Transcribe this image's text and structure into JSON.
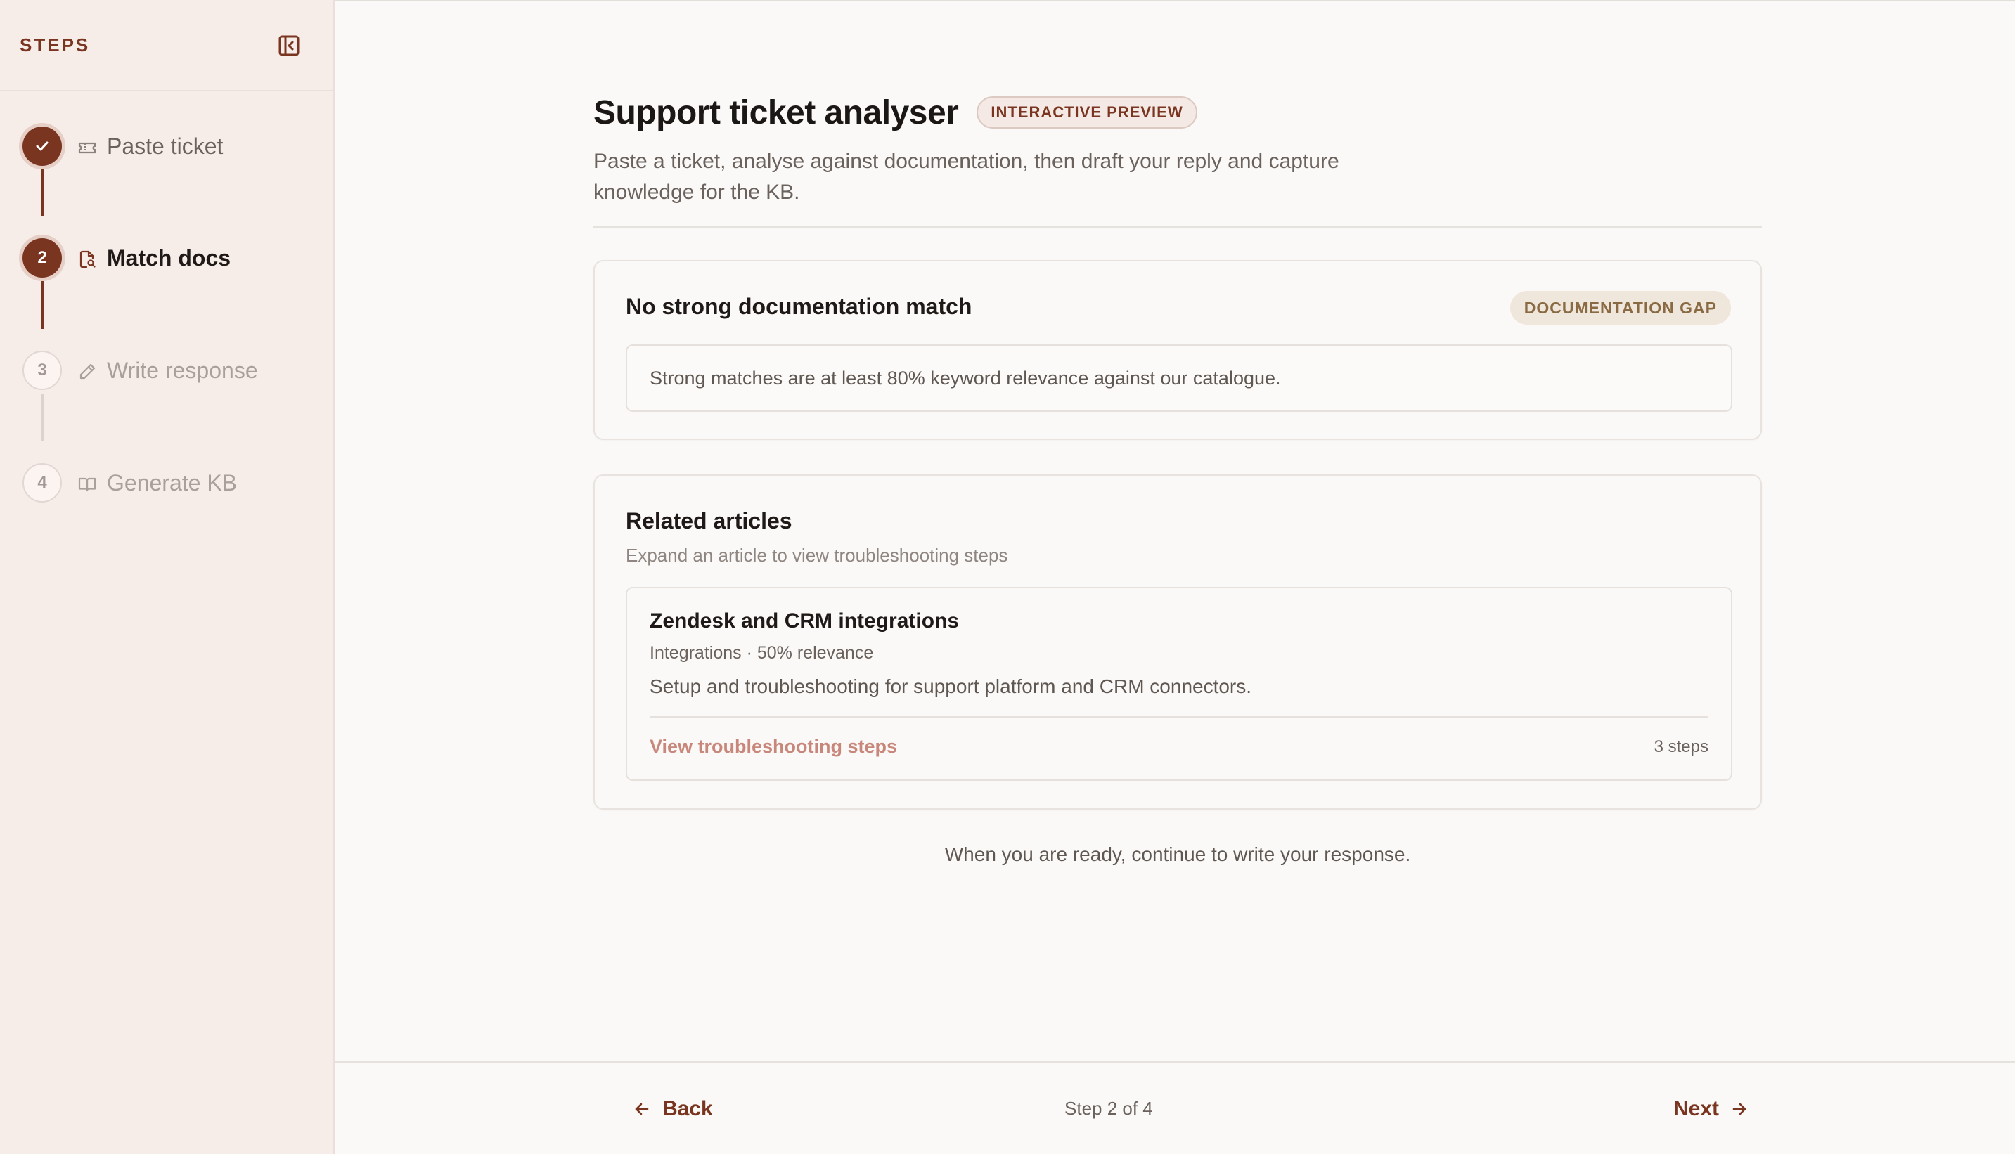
{
  "sidebar": {
    "title": "STEPS",
    "steps": [
      {
        "number": "1",
        "label": "Paste ticket",
        "status": "done",
        "icon": "ticket-icon"
      },
      {
        "number": "2",
        "label": "Match docs",
        "status": "active",
        "icon": "file-search-icon"
      },
      {
        "number": "3",
        "label": "Write response",
        "status": "todo",
        "icon": "pencil-icon"
      },
      {
        "number": "4",
        "label": "Generate KB",
        "status": "todo",
        "icon": "book-icon"
      }
    ]
  },
  "header": {
    "title": "Support ticket analyser",
    "badge": "INTERACTIVE PREVIEW",
    "subtitle": "Paste a ticket, analyse against documentation, then draft your reply and capture knowledge for the KB."
  },
  "match_card": {
    "title": "No strong documentation match",
    "badge": "DOCUMENTATION GAP",
    "note": "Strong matches are at least 80% keyword relevance against our catalogue."
  },
  "related": {
    "title": "Related articles",
    "subtitle": "Expand an article to view troubleshooting steps",
    "articles": [
      {
        "title": "Zendesk and CRM integrations",
        "meta": "Integrations · 50% relevance",
        "description": "Setup and troubleshooting for support platform and CRM connectors.",
        "link": "View troubleshooting steps",
        "steps": "3 steps"
      }
    ]
  },
  "continue_note": "When you are ready, continue to write your response.",
  "footer": {
    "back": "Back",
    "indicator": "Step 2 of 4",
    "next": "Next"
  },
  "colors": {
    "accent": "#7a3520",
    "sidebar_bg": "#f6ece8",
    "link": "#c8877a",
    "gap_badge_bg": "#efe6dc"
  }
}
